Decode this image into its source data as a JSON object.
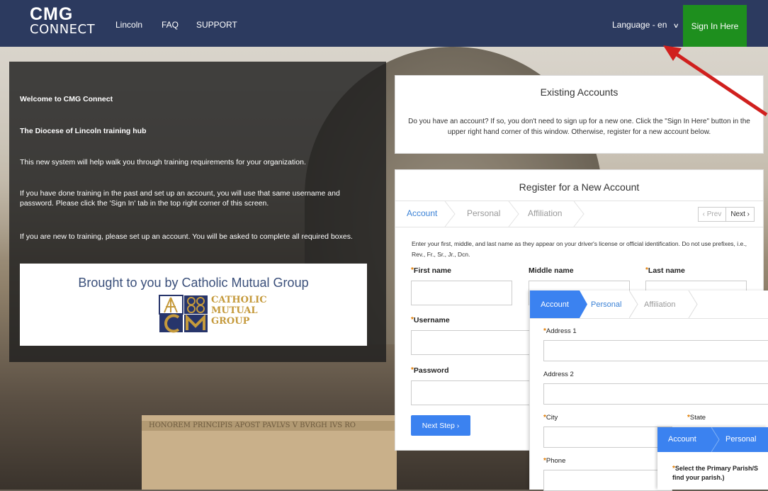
{
  "nav": {
    "logo_line1": "CMG",
    "logo_line2": "CONNECT",
    "links": [
      "Lincoln",
      "FAQ",
      "SUPPORT"
    ],
    "language": "Language - en",
    "signin": "Sign In Here"
  },
  "left": {
    "welcome": "Welcome to CMG Connect",
    "hub": "The Diocese of Lincoln training hub",
    "p1": "This new system will help walk you through training requirements for your organization.",
    "p2": "If you have done training in the past and set up an account, you will use that same username and password.  Please click the 'Sign In' tab in the top right corner of this screen.",
    "p3": "If you are new to training, please set up an account.  You will be asked to complete all required boxes.",
    "brought": "Brought to you by Catholic Mutual Group",
    "logo_words": [
      "CATHOLIC",
      "MUTUAL",
      "GROUP"
    ]
  },
  "existing": {
    "title": "Existing Accounts",
    "text": "Do you have an account? If so, you don't need to sign up for a new one. Click the \"Sign In Here\" button in the upper right hand corner of this window. Otherwise, register for a new account below."
  },
  "register": {
    "title": "Register for a New Account",
    "steps": [
      "Account",
      "Personal",
      "Affiliation"
    ],
    "prev": "Prev",
    "next": "Next",
    "instructions": "Enter your first, middle, and last name as they appear on your driver's license or official identification. Do not use prefixes, i.e., Rev., Fr., Sr., Jr., Dcn.",
    "first_name": "First name",
    "middle_name": "Middle name",
    "last_name": "Last name",
    "username": "Username",
    "password": "Password",
    "next_step": "Next Step"
  },
  "overlay2": {
    "tabs": [
      "Account",
      "Personal",
      "Affiliation"
    ],
    "address1": "Address 1",
    "address2": "Address 2",
    "city": "City",
    "state": "State",
    "phone": "Phone"
  },
  "overlay3": {
    "tabs": [
      "Account",
      "Personal"
    ],
    "question_line1": "Select the Primary Parish/S",
    "question_line2": "find your parish.)"
  },
  "bg": {
    "frieze": "HONOREM PRINCIPIS APOST PAVLVS V BVRGH   IVS RO"
  },
  "colors": {
    "navbar": "#2c3a5f",
    "signin": "#1e8f1e",
    "accent": "#3b82f0",
    "required": "#e07b00",
    "arrow": "#d0201e"
  }
}
